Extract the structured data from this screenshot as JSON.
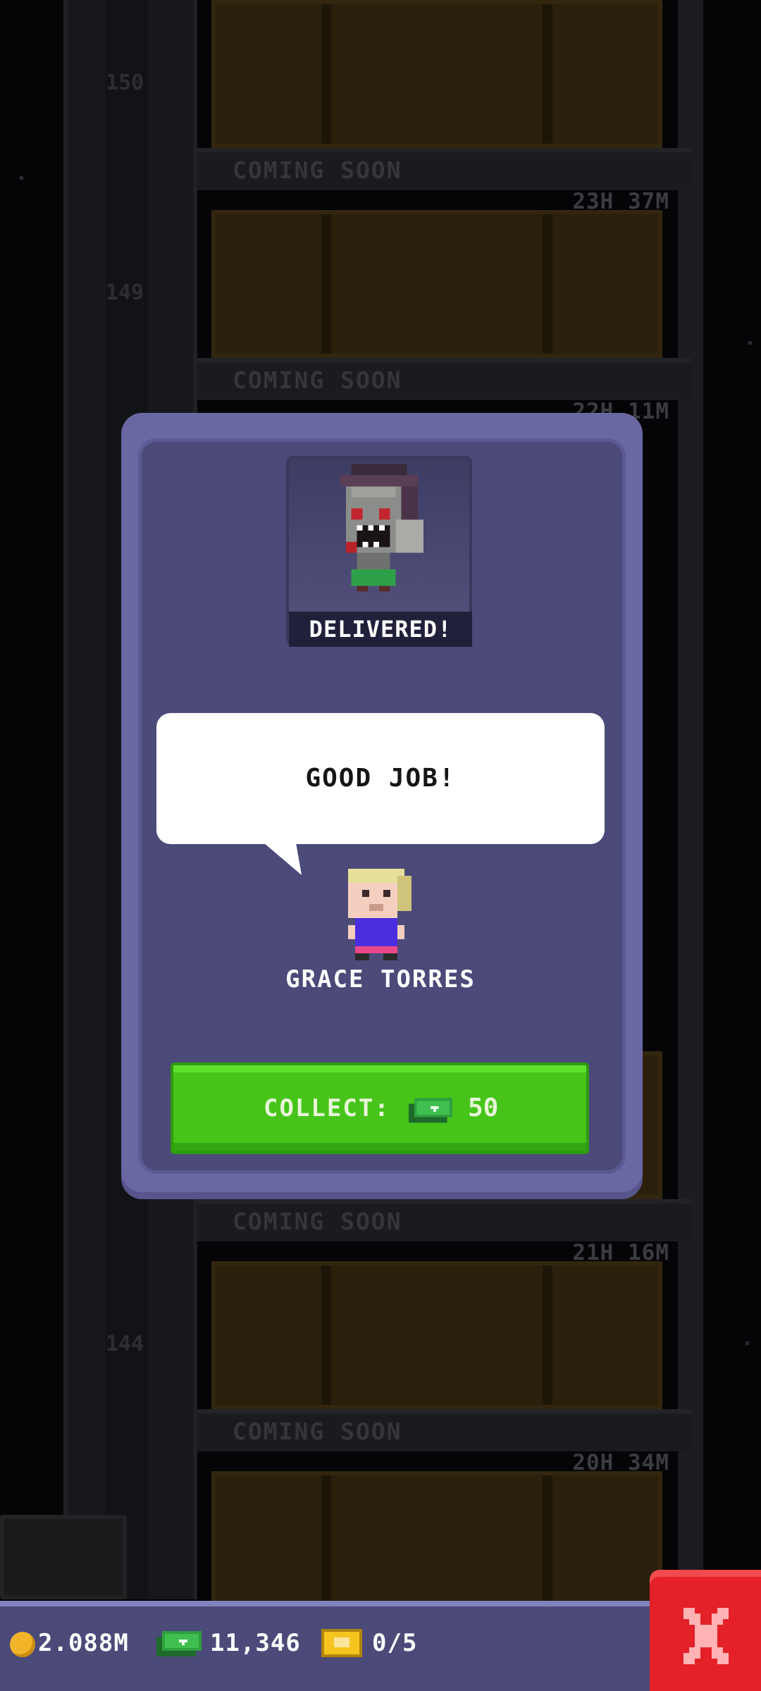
{
  "tower": {
    "floors": [
      {
        "status": "COMING SOON",
        "timer": "23H 37M",
        "number": "150"
      },
      {
        "status": "COMING SOON",
        "timer": "22H 11M",
        "number": "149"
      },
      {
        "status": "COMING SOON",
        "timer": "21H 16M",
        "number": ""
      },
      {
        "status": "COMING SOON",
        "timer": "20H 34M",
        "number": "144"
      }
    ]
  },
  "delivery": {
    "badge": "DELIVERED!",
    "portrait_icon": "zombie-bitizen-icon"
  },
  "dialog": {
    "message": "GOOD JOB!",
    "speaker_name": "GRACE TORRES"
  },
  "collect_button": {
    "label": "COLLECT:",
    "amount": "50",
    "icon": "bux-cash-icon"
  },
  "status_bar": {
    "coins": "2.088M",
    "bux": "11,346",
    "tickets": "0/5"
  },
  "colors": {
    "panel": "#6a68a2",
    "panel_inner": "#4b4a79",
    "collect_green": "#46c41a",
    "close_red": "#e42028"
  }
}
